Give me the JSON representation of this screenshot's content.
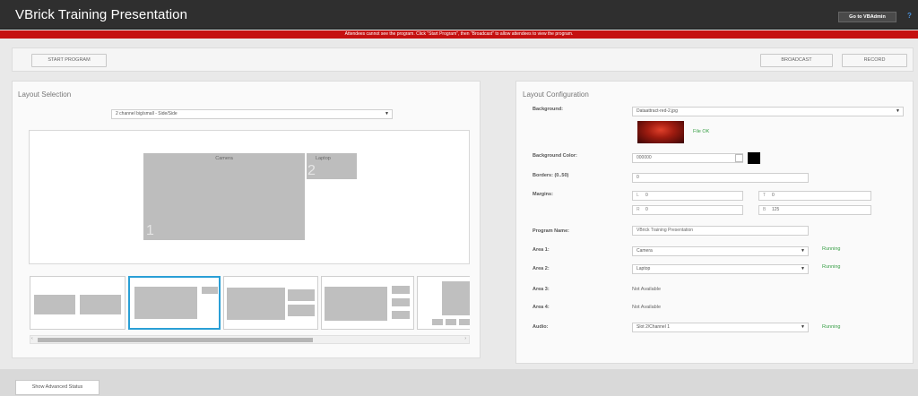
{
  "app": {
    "title": "VBrick Training Presentation",
    "admin_button": "Go to VBAdmin",
    "help_label": "?"
  },
  "alert": {
    "text": "Attendees cannot see the program. Click \"Start Program\", then \"Broadcast\" to allow attendees to view the program."
  },
  "toolbar": {
    "start_program": "START PROGRAM",
    "broadcast": "BROADCAST",
    "record": "RECORD"
  },
  "layout_selection": {
    "title": "Layout Selection",
    "selected_layout": "2 channel big/small - Side/Side",
    "preview": {
      "area1_label": "Camera",
      "area1_number": "1",
      "area2_label": "Laptop",
      "area2_number": "2"
    },
    "scroll_left": "‹",
    "scroll_right": "›"
  },
  "layout_configuration": {
    "title": "Layout Configuration",
    "background_label": "Background:",
    "background_value": "Dataattract-red-2.jpg",
    "file_status": "File OK",
    "background_color_label": "Background Color:",
    "background_color_value": "000000",
    "borders_label": "Borders: (0..50)",
    "borders_value": "0",
    "margins_label": "Margins:",
    "margins": {
      "L_label": "L",
      "L_value": "0",
      "T_label": "T",
      "T_value": "0",
      "R_label": "R",
      "R_value": "0",
      "B_label": "B",
      "B_value": "125"
    },
    "program_name_label": "Program Name:",
    "program_name_value": "VBrick Training Presentation",
    "area1_label": "Area 1:",
    "area1_value": "Camera",
    "area1_status": "Running",
    "area2_label": "Area 2:",
    "area2_value": "Laptop",
    "area2_status": "Running",
    "area3_label": "Area 3:",
    "area3_value": "Not Available",
    "area4_label": "Area 4:",
    "area4_value": "Not Available",
    "audio_label": "Audio:",
    "audio_value": "Slot 2/Channel 1",
    "audio_status": "Running"
  },
  "footer": {
    "advanced_status_button": "Show Advanced Status"
  },
  "colors": {
    "alert_red": "#c51010",
    "selected_thumb": "#2a9fd6",
    "running_green": "#3aa048",
    "titlebar": "#2f2f2f"
  }
}
